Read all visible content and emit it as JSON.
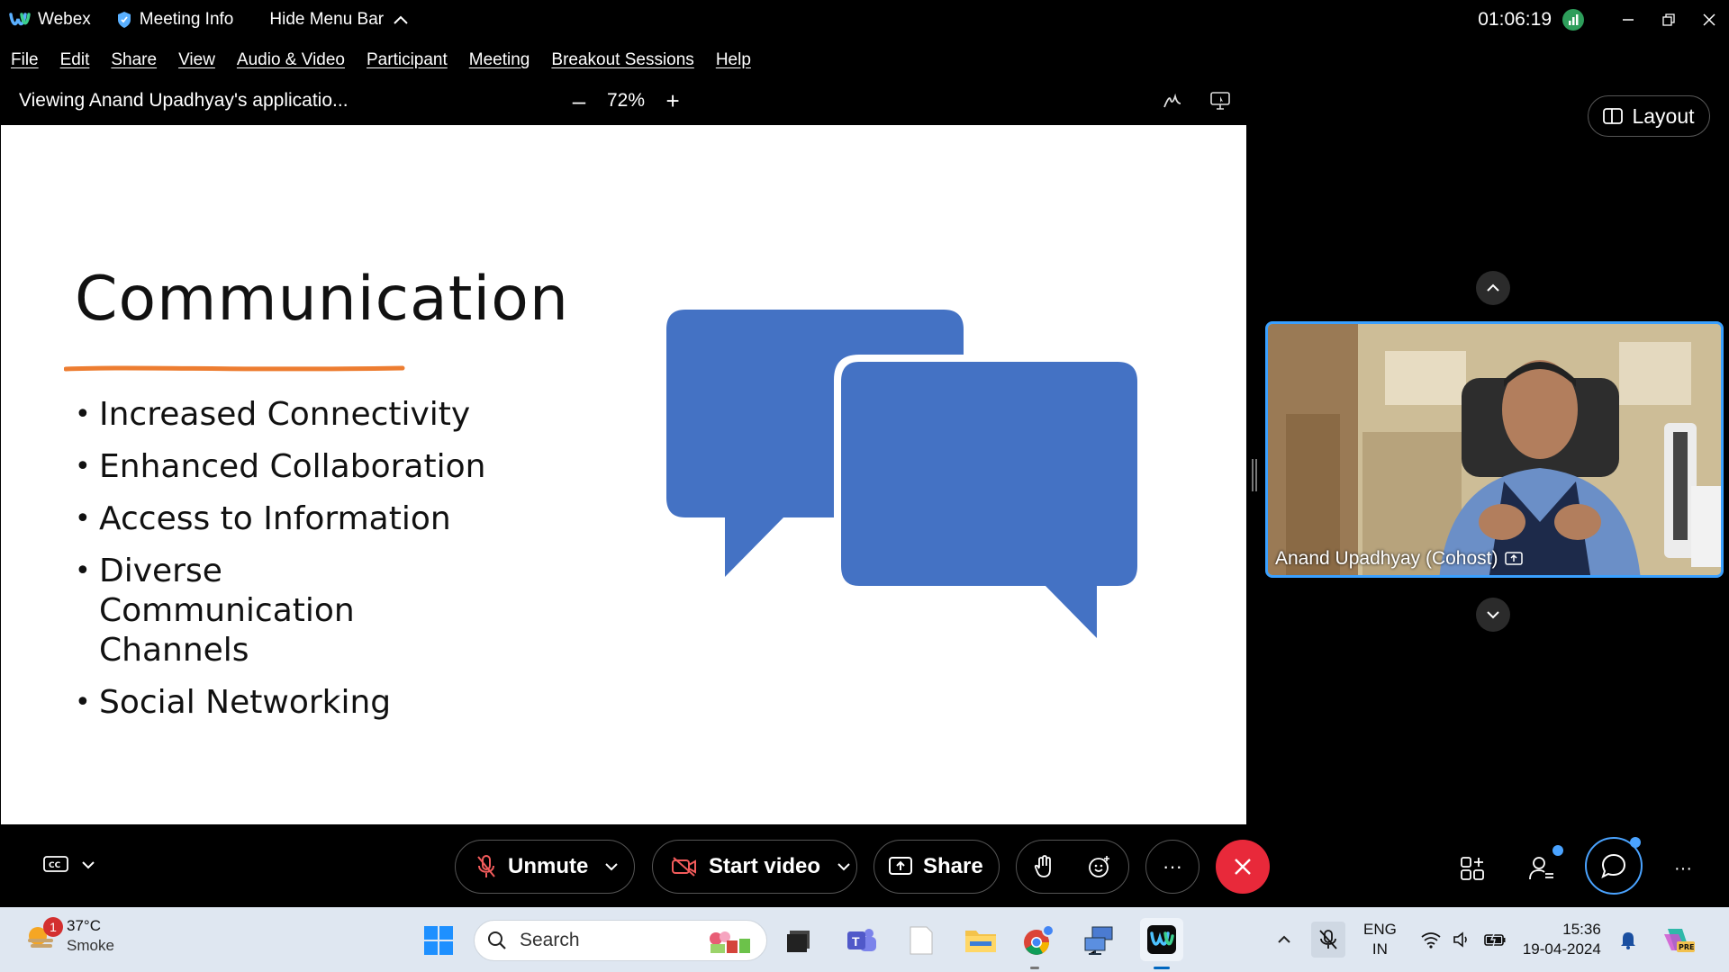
{
  "titlebar": {
    "app_name": "Webex",
    "meeting_info": "Meeting Info",
    "hide_menu_bar": "Hide Menu Bar",
    "timer": "01:06:19"
  },
  "menu": [
    "File",
    "Edit",
    "Share",
    "View",
    "Audio & Video",
    "Participant",
    "Meeting",
    "Breakout Sessions",
    "Help"
  ],
  "viewbar": {
    "viewing_text": "Viewing Anand Upadhyay's applicatio...",
    "zoom_level": "72%",
    "layout_label": "Layout"
  },
  "slide": {
    "title": "Communication",
    "bullets": [
      "Increased Connectivity",
      "Enhanced Collaboration",
      "Access to Information",
      "Diverse Communication Channels",
      "Social Networking"
    ],
    "accent_color": "#ed7d31",
    "bubble_color": "#4472c4"
  },
  "participant": {
    "name": "Anand Upadhyay (Cohost)"
  },
  "controls": {
    "unmute": "Unmute",
    "start_video": "Start video",
    "share": "Share",
    "more": "···"
  },
  "taskbar": {
    "weather_badge": "1",
    "temperature": "37°C",
    "condition": "Smoke",
    "search_placeholder": "Search",
    "lang_top": "ENG",
    "lang_bottom": "IN",
    "time": "15:36",
    "date": "19-04-2024"
  },
  "colors": {
    "end_call": "#e8293a",
    "accent_blue": "#3aa0ff",
    "taskbar_bg": "#dfe7f1"
  }
}
